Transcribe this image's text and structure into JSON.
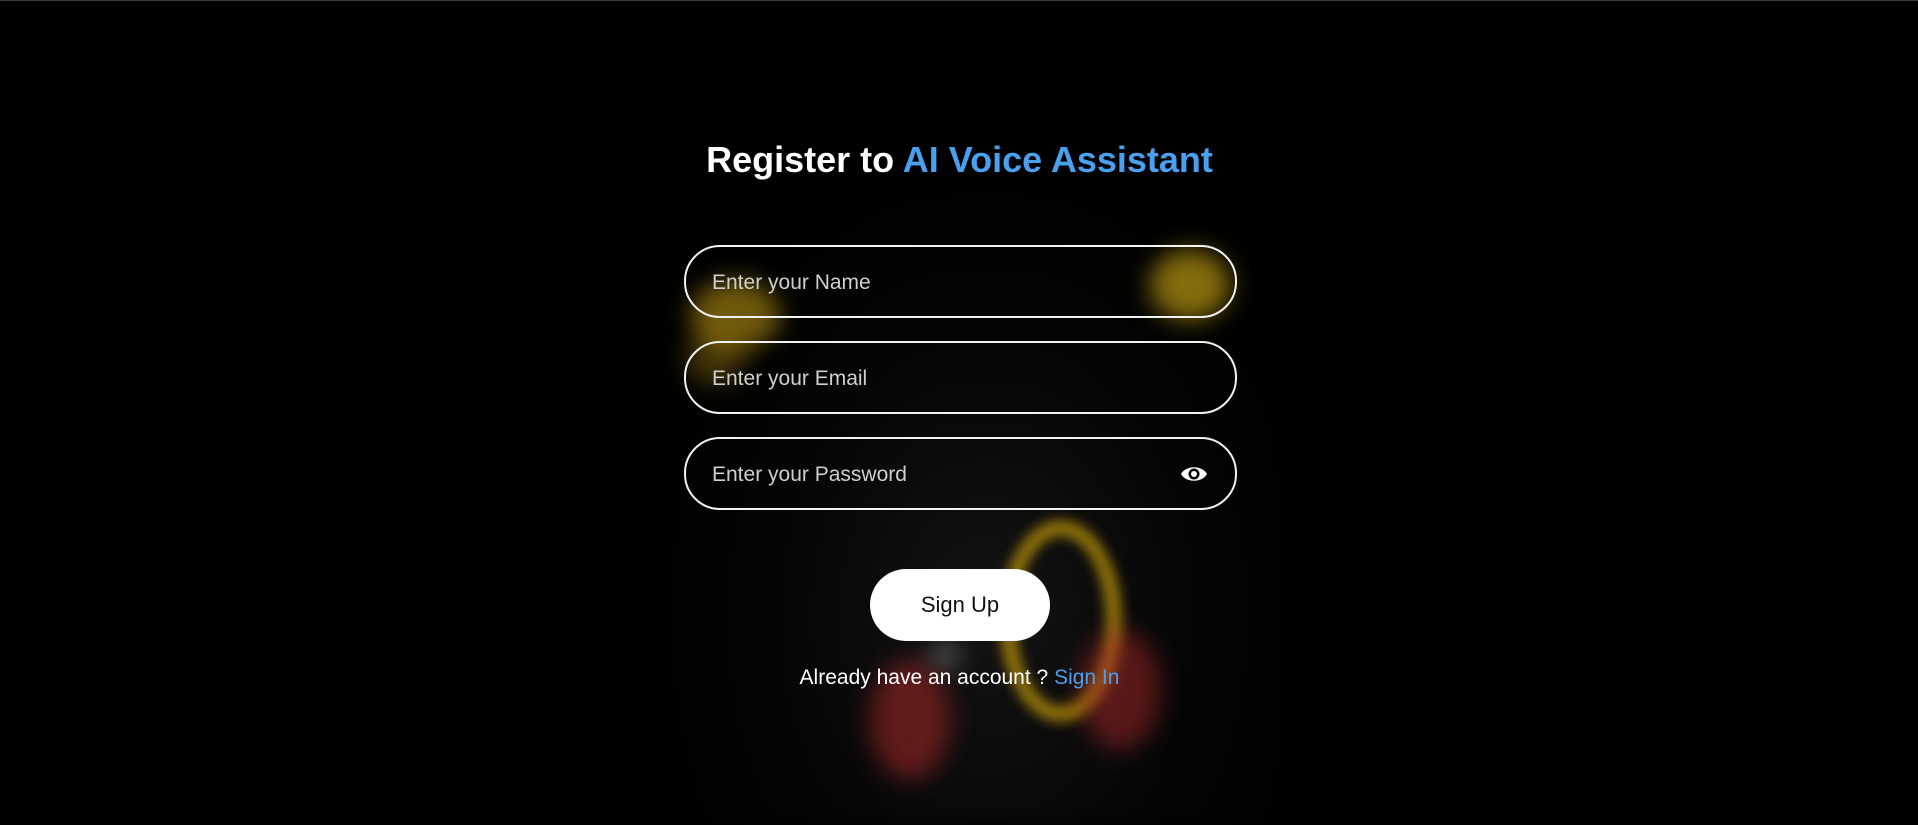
{
  "page": {
    "background_color": "#000000",
    "accent_color": "#4aa0f0"
  },
  "title": {
    "prefix": "Register to",
    "accent": "AI Voice Assistant"
  },
  "form": {
    "name": {
      "placeholder": "Enter your Name",
      "value": ""
    },
    "email": {
      "placeholder": "Enter your Email",
      "value": ""
    },
    "password": {
      "placeholder": "Enter your Password",
      "value": "",
      "toggle_icon": "eye-icon"
    },
    "submit_label": "Sign Up"
  },
  "footer": {
    "prompt": "Already have an account ?",
    "link_label": "Sign In"
  }
}
